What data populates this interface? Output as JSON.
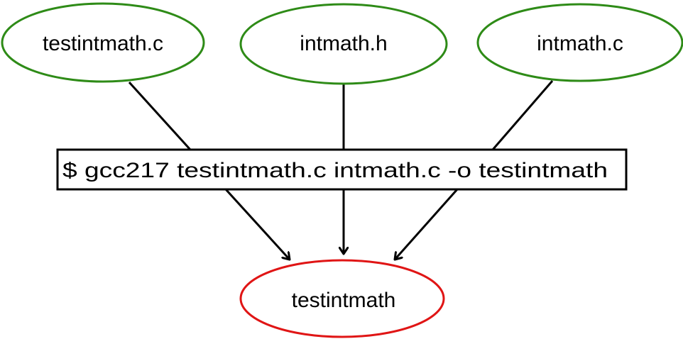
{
  "colors": {
    "input_stroke": "#2e8b17",
    "output_stroke": "#e01515",
    "line": "#000000"
  },
  "inputs": [
    {
      "label": "testintmath.c"
    },
    {
      "label": "intmath.h"
    },
    {
      "label": "intmath.c"
    }
  ],
  "command": {
    "label": "$ gcc217 testintmath.c intmath.c -o testintmath"
  },
  "output": {
    "label": "testintmath"
  }
}
